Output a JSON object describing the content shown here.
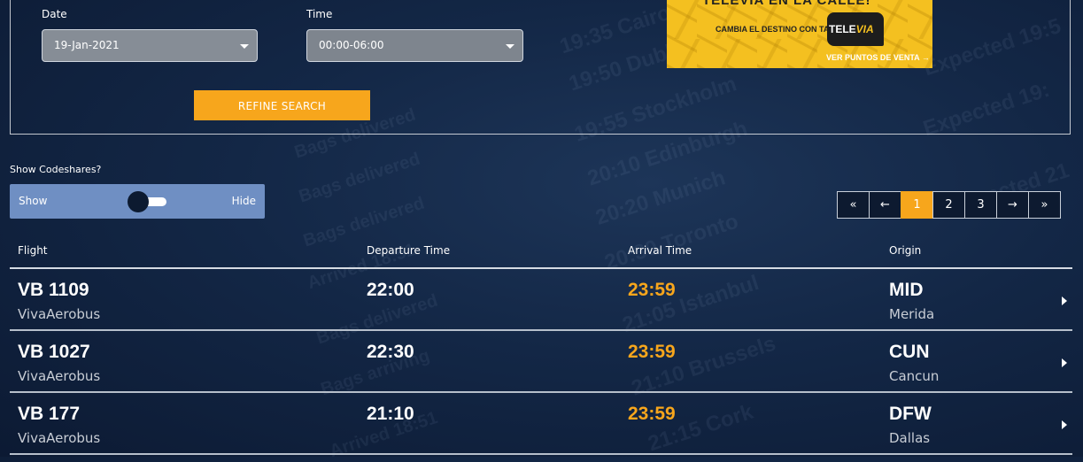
{
  "search": {
    "date_label": "Date",
    "date_value": "19-Jan-2021",
    "time_label": "Time",
    "time_value": "00:00-06:00",
    "refine_label": "REFINE SEARCH"
  },
  "ad": {
    "headline": "TELEVIA EN LA CALLE!",
    "tagline": "CAMBIA EL DESTINO CON TAG",
    "logo_prefix": "TELE",
    "logo_suffix": "VIA",
    "footer": "VER PUNTOS DE VENTA →"
  },
  "codeshare": {
    "label": "Show Codeshares?",
    "show": "Show",
    "hide": "Hide"
  },
  "pagination": {
    "first": "«",
    "prev": "←",
    "pages": [
      "1",
      "2",
      "3"
    ],
    "next": "→",
    "last": "»"
  },
  "table": {
    "headers": {
      "flight": "Flight",
      "departure": "Departure Time",
      "arrival": "Arrival Time",
      "origin": "Origin"
    },
    "rows": [
      {
        "flight": "VB 1109",
        "airline": "VivaAerobus",
        "departure": "22:00",
        "arrival": "23:59",
        "origin_code": "MID",
        "origin_city": "Merida"
      },
      {
        "flight": "VB 1027",
        "airline": "VivaAerobus",
        "departure": "22:30",
        "arrival": "23:59",
        "origin_code": "CUN",
        "origin_city": "Cancun"
      },
      {
        "flight": "VB 177",
        "airline": "VivaAerobus",
        "departure": "21:10",
        "arrival": "23:59",
        "origin_code": "DFW",
        "origin_city": "Dallas"
      }
    ]
  },
  "colors": {
    "accent": "#f7a61c",
    "background": "#132746",
    "toggle": "#6f8fc3"
  }
}
